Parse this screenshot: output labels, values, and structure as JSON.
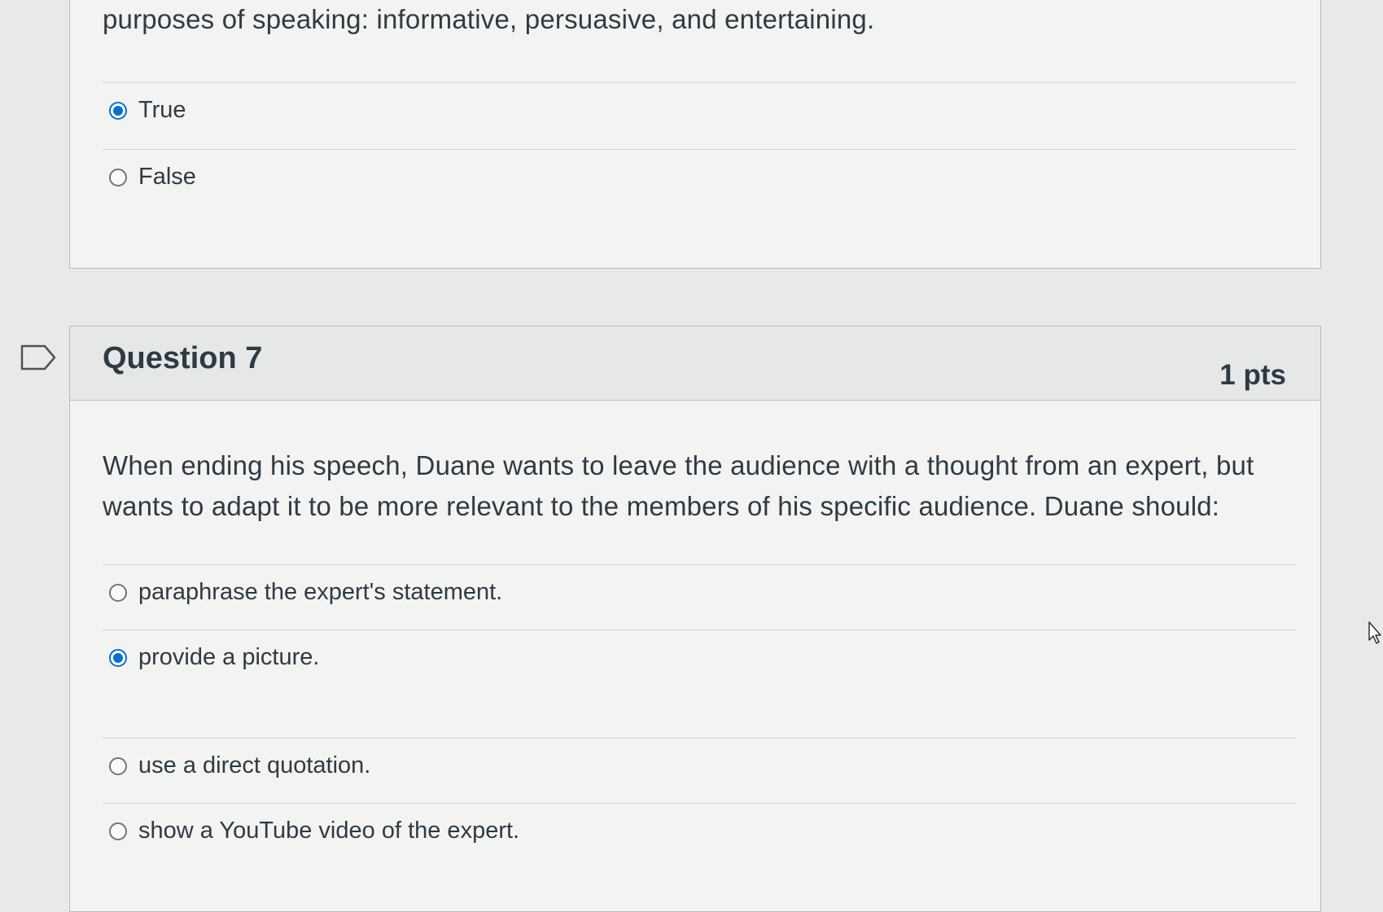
{
  "previous_question": {
    "text": "purposes of speaking: informative, persuasive, and entertaining.",
    "answers": [
      {
        "label": "True",
        "selected": true
      },
      {
        "label": "False",
        "selected": false
      }
    ]
  },
  "question7": {
    "title": "Question 7",
    "points": "1 pts",
    "text": "When ending his speech, Duane wants to leave the audience with a thought from an expert, but wants to adapt it to be more relevant to the members of his specific audience. Duane should:",
    "answers": [
      {
        "label": "paraphrase the expert's statement.",
        "selected": false
      },
      {
        "label": "provide a picture.",
        "selected": true
      },
      {
        "label": "use a direct quotation.",
        "selected": false
      },
      {
        "label": "show a YouTube video of the expert.",
        "selected": false
      }
    ]
  },
  "colors": {
    "radio_selected": "#0770cf",
    "text": "#2d3b45"
  },
  "icons": {
    "flag": "flag-question-icon",
    "cursor": "mouse-pointer-icon"
  }
}
